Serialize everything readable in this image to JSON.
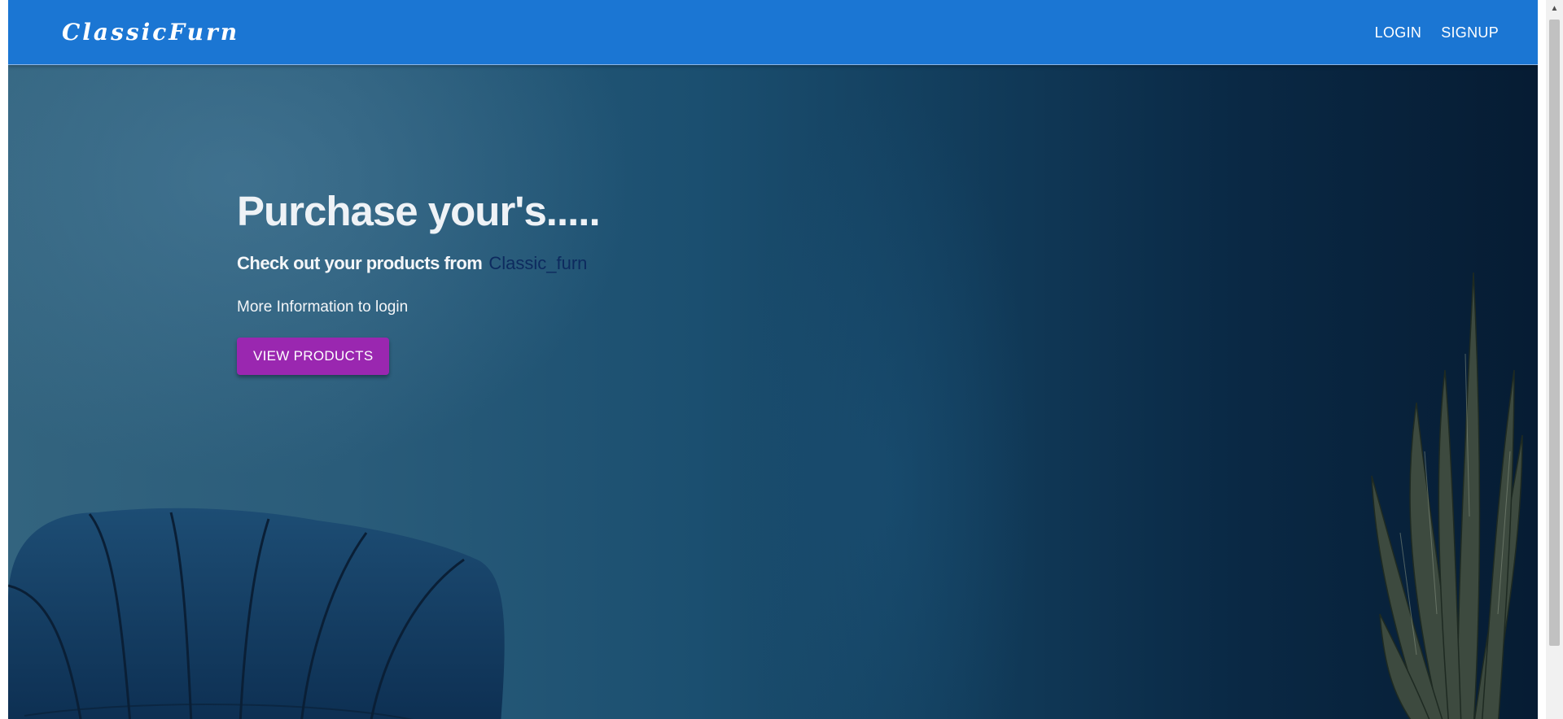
{
  "header": {
    "brand": "ClassicFurn",
    "nav": {
      "login": "LOGIN",
      "signup": "SIGNUP"
    }
  },
  "hero": {
    "title": "Purchase your's.....",
    "subtitle": "Check out your products from",
    "brand_link": "Classic_furn",
    "info": "More Information to login",
    "cta": "VIEW PRODUCTS"
  },
  "colors": {
    "appbar": "#1b76d3",
    "cta": "#9a27b0",
    "brand_link": "#0d2a5e"
  },
  "icons": {
    "scroll_up": "scroll-up-arrow-icon"
  }
}
